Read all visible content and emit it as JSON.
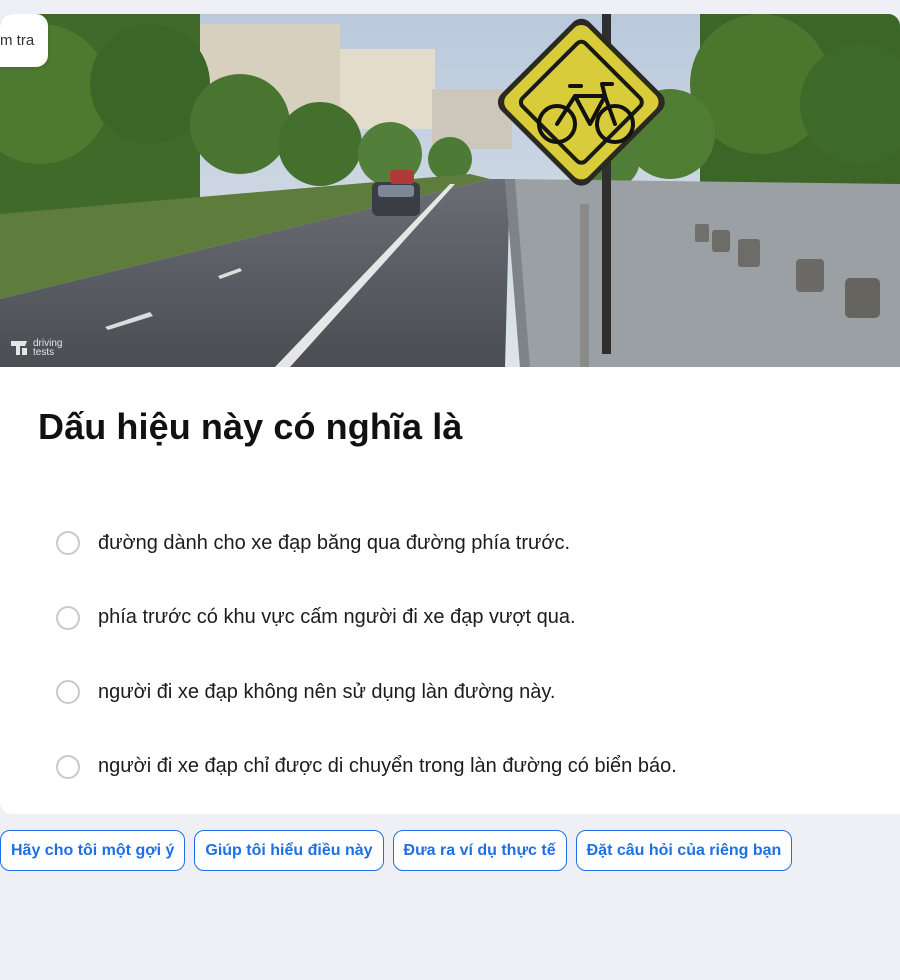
{
  "tab_pill": {
    "label": "m tra"
  },
  "hero": {
    "alt": "Biển báo xe đạp trên đường",
    "watermark_line1": "driving",
    "watermark_line2": "tests"
  },
  "question": {
    "title": "Dấu hiệu này có nghĩa là"
  },
  "options": [
    {
      "label": "đường dành cho xe đạp băng qua đường phía trước."
    },
    {
      "label": "phía trước có khu vực cấm người đi xe đạp vượt qua."
    },
    {
      "label": "người đi xe đạp không nên sử dụng làn đường này."
    },
    {
      "label": "người đi xe đạp chỉ được di chuyển trong làn đường có biển báo."
    }
  ],
  "suggestions": [
    {
      "label": "Hãy cho tôi một gợi ý"
    },
    {
      "label": "Giúp tôi hiểu điều này"
    },
    {
      "label": "Đưa ra ví dụ thực tế"
    },
    {
      "label": "Đặt câu hỏi của riêng bạn"
    }
  ],
  "colors": {
    "accent": "#1f6fe5",
    "page_bg": "#eff0f5",
    "sign_yellow": "#e2d43a"
  }
}
